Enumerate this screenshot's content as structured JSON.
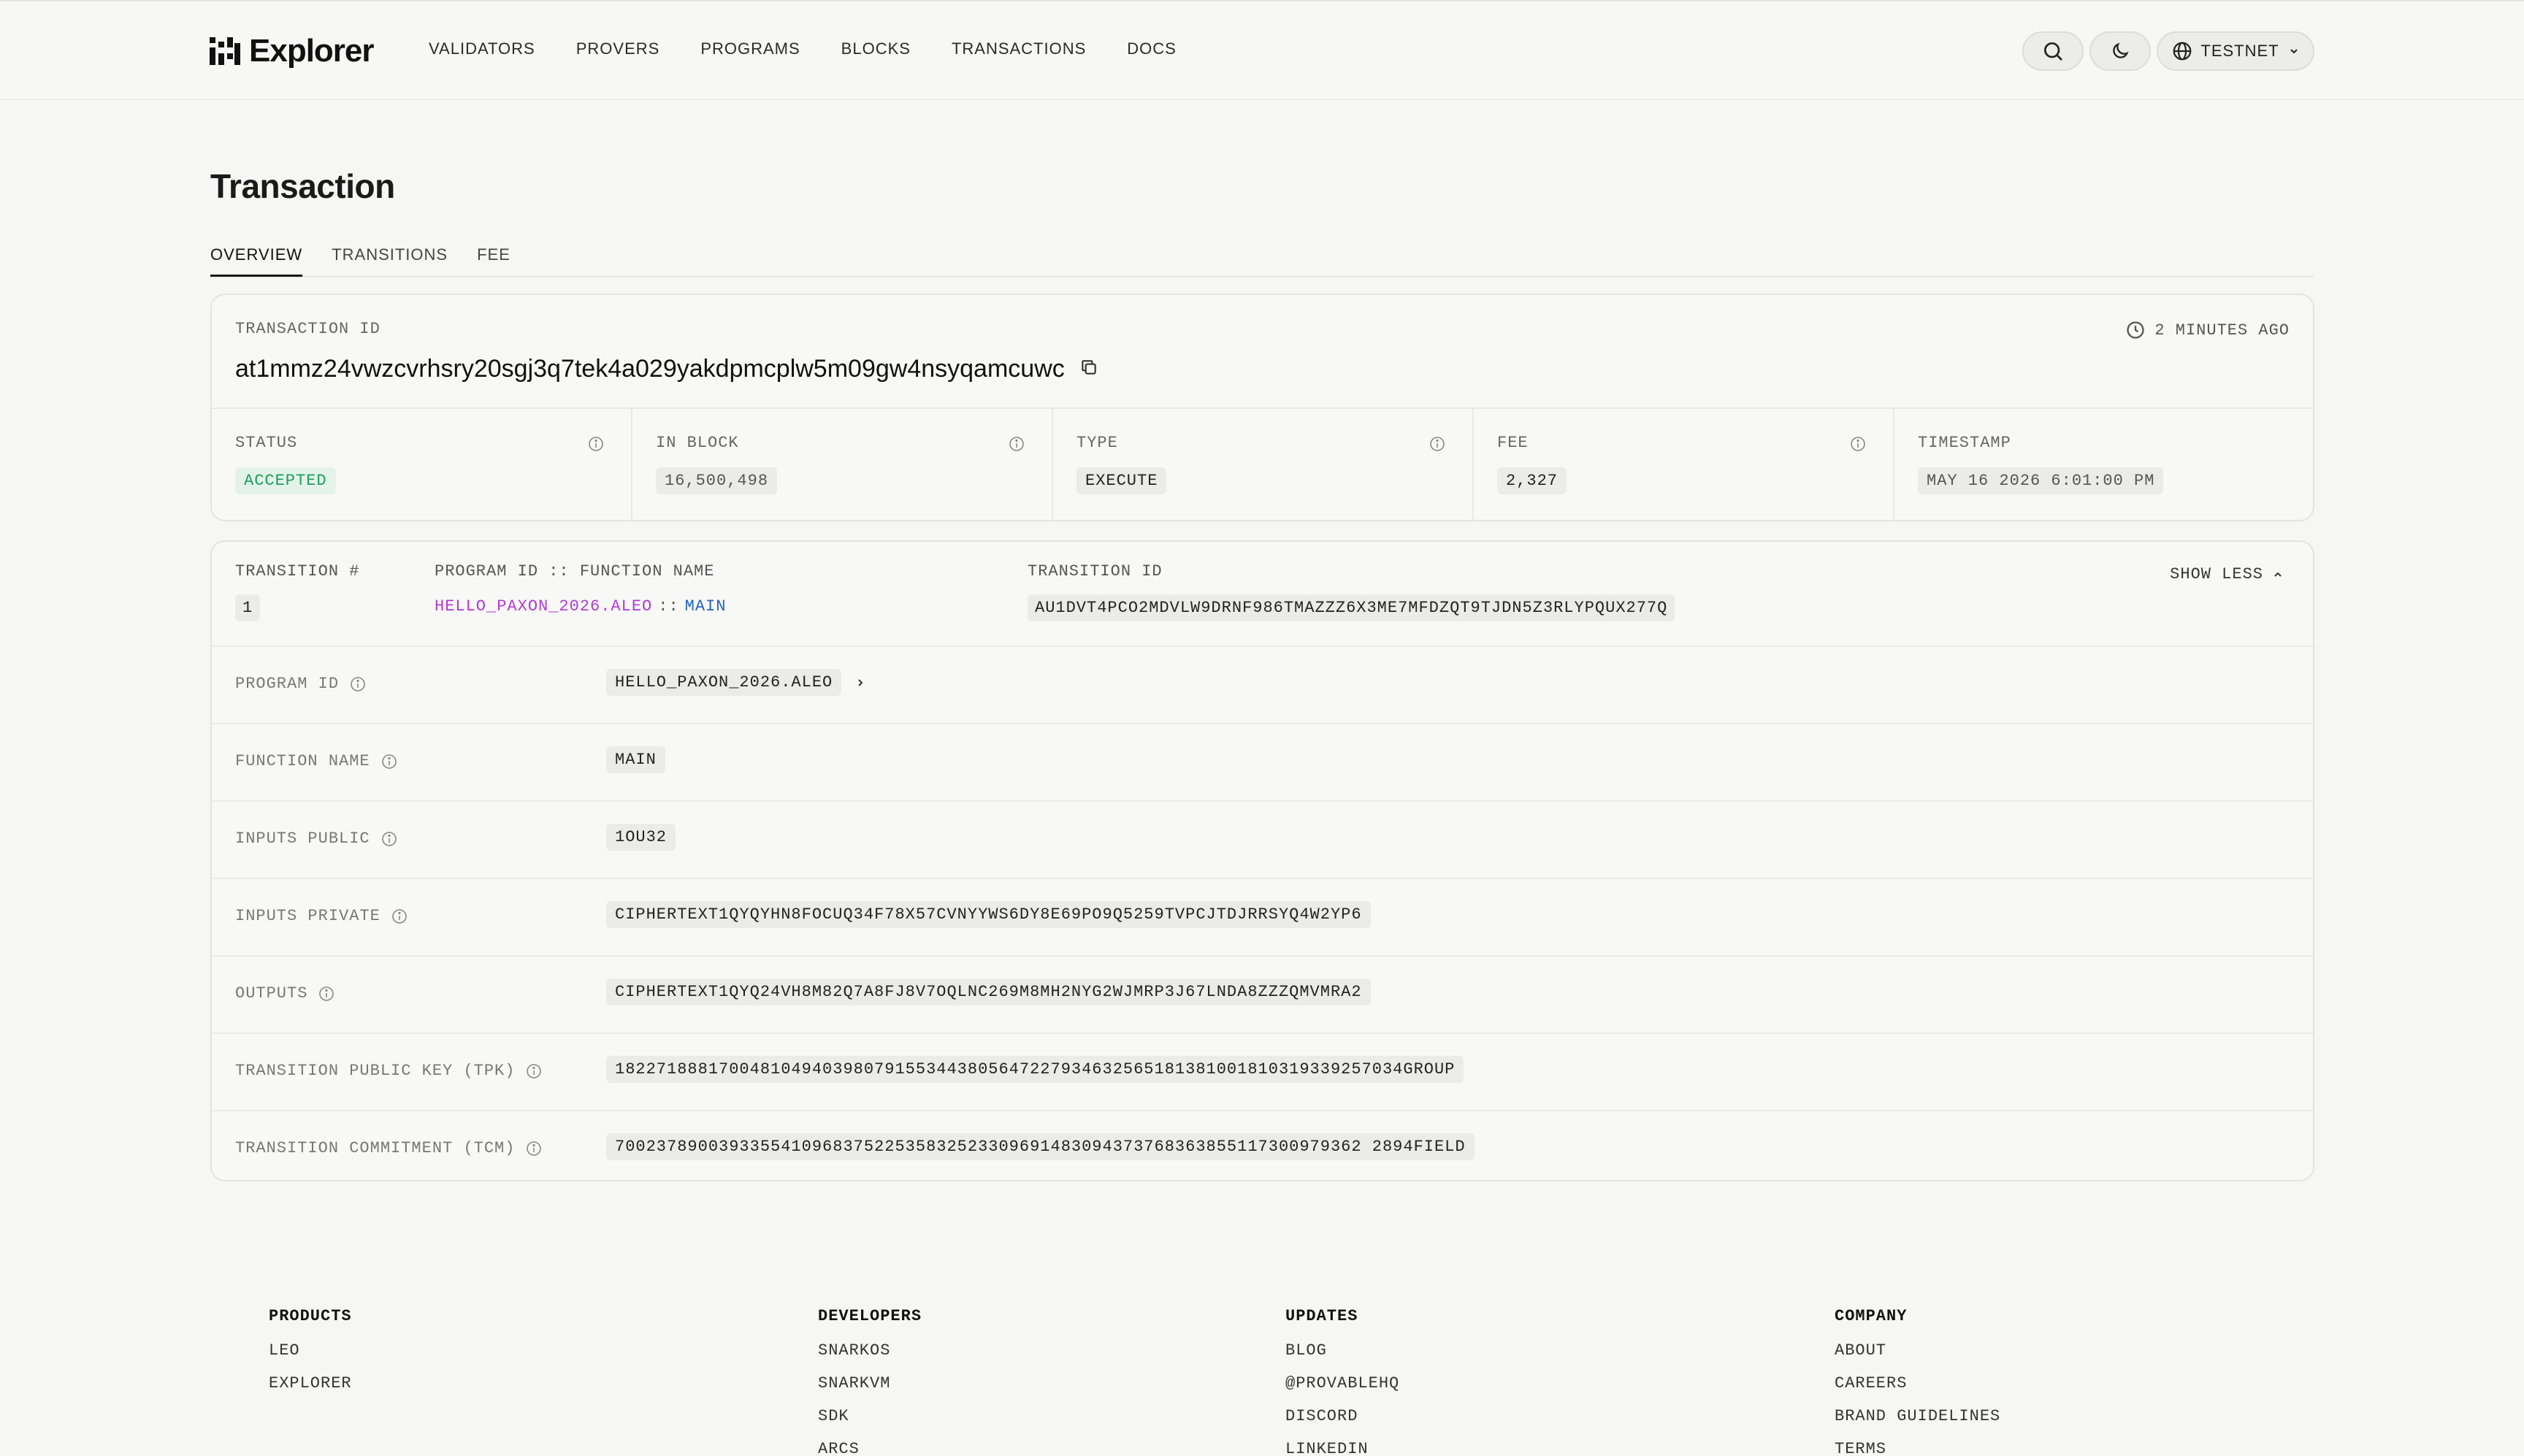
{
  "header": {
    "logo_text": "Explorer",
    "nav": [
      "VALIDATORS",
      "PROVERS",
      "PROGRAMS",
      "BLOCKS",
      "TRANSACTIONS",
      "DOCS"
    ],
    "network_label": "TESTNET",
    "icons": {
      "search": "search-icon",
      "theme": "moon-icon",
      "network": "globe-icon",
      "dropdown": "chevron-down-icon"
    }
  },
  "page": {
    "title": "Transaction",
    "tabs": [
      {
        "label": "OVERVIEW",
        "active": true
      },
      {
        "label": "TRANSITIONS",
        "active": false
      },
      {
        "label": "FEE",
        "active": false
      }
    ]
  },
  "summary": {
    "transaction_id_label": "TRANSACTION ID",
    "transaction_id": "at1mmz24vwzcvrhsry20sgj3q7tek4a029yakdpmcplw5m09gw4nsyqamcuwc",
    "time_ago": "2 MINUTES AGO",
    "stats": [
      {
        "label": "STATUS",
        "value": "ACCEPTED",
        "style": "green"
      },
      {
        "label": "IN BLOCK",
        "value": "16,500,498",
        "style": "muted"
      },
      {
        "label": "TYPE",
        "value": "EXECUTE",
        "style": "plain"
      },
      {
        "label": "FEE",
        "value": "2,327",
        "style": "plain"
      },
      {
        "label": "TIMESTAMP",
        "value": "MAY 16 2026 6:01:00 PM",
        "style": "muted"
      }
    ]
  },
  "transition": {
    "headers": {
      "number": "TRANSITION #",
      "program_function": "PROGRAM ID :: FUNCTION NAME",
      "transition_id": "TRANSITION ID"
    },
    "number": "1",
    "program": "HELLO_PAXON_2026.ALEO",
    "separator": "::",
    "function": "MAIN",
    "transition_id": "AU1DVT4PCO2MDVLW9DRNF986TMAZZZ6X3ME7MFDZQT9TJDN5Z3RLYPQUX277Q",
    "toggle_label": "SHOW LESS",
    "details": [
      {
        "label": "PROGRAM ID",
        "value": "HELLO_PAXON_2026.ALEO",
        "link": true
      },
      {
        "label": "FUNCTION NAME",
        "value": "MAIN",
        "link": false
      },
      {
        "label": "INPUTS PUBLIC",
        "value": "1OU32",
        "link": false
      },
      {
        "label": "INPUTS PRIVATE",
        "value": "CIPHERTEXT1QYQYHN8FOCUQ34F78X57CVNYYWS6DY8E69PO9Q5259TVPCJTDJRRSYQ4W2YP6",
        "link": false
      },
      {
        "label": "OUTPUTS",
        "value": "CIPHERTEXT1QYQ24VH8M82Q7A8FJ8V7OQLNC269M8MH2NYG2WJMRP3J67LNDA8ZZZQMVMRA2",
        "link": false
      },
      {
        "label": "TRANSITION PUBLIC KEY (TPK)",
        "value": "1822718881700481049403980791553443805647227934632565181381001810319339257034GROUP",
        "link": false
      },
      {
        "label": "TRANSITION COMMITMENT (TCM)",
        "value": "700237890039335541096837522535832523309691483094373768363855117300979362 2894FIELD",
        "link": false
      }
    ]
  },
  "footer": {
    "columns": [
      {
        "title": "PRODUCTS",
        "links": [
          "LEO",
          "EXPLORER"
        ]
      },
      {
        "title": "DEVELOPERS",
        "links": [
          "SNARKOS",
          "SNARKVM",
          "SDK",
          "ARCS"
        ]
      },
      {
        "title": "UPDATES",
        "links": [
          "BLOG",
          "@PROVABLEHQ",
          "DISCORD",
          "LINKEDIN"
        ]
      },
      {
        "title": "COMPANY",
        "links": [
          "ABOUT",
          "CAREERS",
          "BRAND GUIDELINES",
          "TERMS"
        ]
      }
    ]
  }
}
